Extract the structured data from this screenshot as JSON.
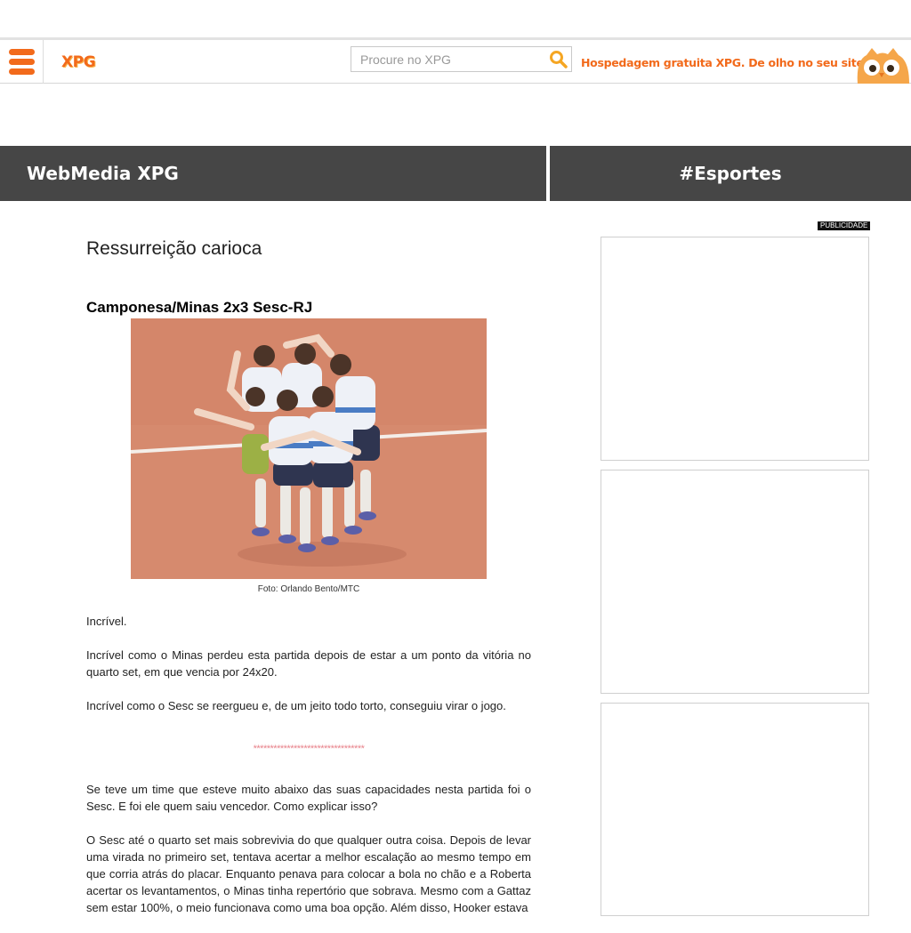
{
  "header": {
    "logo": "XPG",
    "search_placeholder": "Procure no XPG",
    "promo": "Hospedagem gratuita XPG. De olho no seu site.",
    "brand_color": "#f26a1b"
  },
  "sections": {
    "left": "WebMedia XPG",
    "right": "#Esportes"
  },
  "article": {
    "title": "Ressurreição carioca",
    "match": "Camponesa/Minas 2x3 Sesc-RJ",
    "caption": "Foto: Orlando Bento/MTC",
    "paragraphs": [
      "Incrível.",
      "Incrível como o Minas perdeu esta partida depois de estar a um ponto da vitória no quarto set, em que vencia por 24x20.",
      "Incrível como o Sesc se reergueu e, de um jeito todo torto, conseguiu virar o jogo."
    ],
    "separator": "*********************************",
    "paragraphs2": [
      "Se teve um time que esteve muito abaixo das suas capacidades nesta partida foi o Sesc. E foi ele quem saiu vencedor. Como explicar isso?",
      "O Sesc até o quarto set mais sobrevivia do que qualquer outra coisa. Depois de levar uma virada no primeiro set, tentava acertar a melhor escalação ao mesmo tempo em que corria atrás do placar. Enquanto penava para colocar a bola no chão e a Roberta acertar os levantamentos, o Minas tinha repertório que sobrava. Mesmo com a Gattaz sem estar 100%, o meio funcionava como uma boa opção. Além disso, Hooker estava"
    ]
  },
  "sidebar": {
    "ad_label": "PUBLICIDADE"
  }
}
